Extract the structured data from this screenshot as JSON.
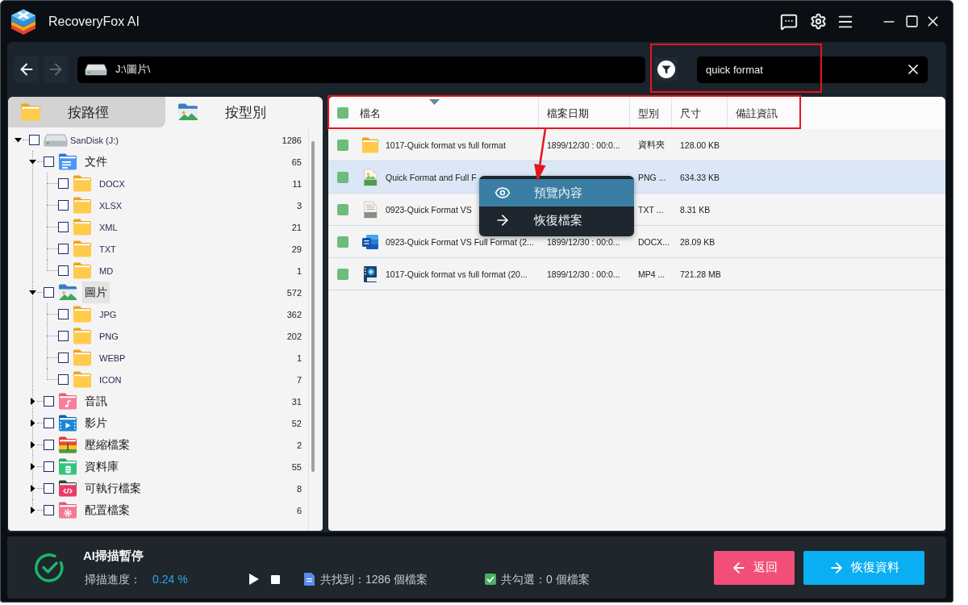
{
  "window": {
    "title": "RecoveryFox AI"
  },
  "toolbar": {
    "navigation": [
      {
        "kind": "back",
        "disabled": false
      },
      {
        "kind": "forward",
        "disabled": true
      }
    ],
    "path": "J:\\圖片\\",
    "search": {
      "value": "quick format"
    }
  },
  "view_tabs": [
    {
      "kind": "folder",
      "label": "按路徑",
      "selected": false
    },
    {
      "kind": "image",
      "label": "按型別",
      "selected": true
    }
  ],
  "tree": [
    {
      "kind": "drive",
      "label": "SanDisk (J:)",
      "count": "1286",
      "checked": false,
      "expanded": true,
      "selected": false,
      "children": [
        {
          "kind": "document",
          "label": "文件",
          "count": "65",
          "checked": false,
          "expanded": true,
          "selected": false,
          "children": [
            {
              "kind": "folder",
              "label": "DOCX",
              "count": "11",
              "checked": false,
              "selected": false
            },
            {
              "kind": "folder",
              "label": "XLSX",
              "count": "3",
              "checked": false,
              "selected": false
            },
            {
              "kind": "folder",
              "label": "XML",
              "count": "21",
              "checked": false,
              "selected": false
            },
            {
              "kind": "folder",
              "label": "TXT",
              "count": "29",
              "checked": false,
              "selected": false
            },
            {
              "kind": "folder",
              "label": "MD",
              "count": "1",
              "checked": false,
              "selected": false
            }
          ]
        },
        {
          "kind": "image",
          "label": "圖片",
          "count": "572",
          "checked": false,
          "expanded": true,
          "selected": true,
          "children": [
            {
              "kind": "folder",
              "label": "JPG",
              "count": "362",
              "checked": false,
              "selected": false
            },
            {
              "kind": "folder",
              "label": "PNG",
              "count": "202",
              "checked": false,
              "selected": false
            },
            {
              "kind": "folder",
              "label": "WEBP",
              "count": "1",
              "checked": false,
              "selected": false
            },
            {
              "kind": "folder",
              "label": "ICON",
              "count": "7",
              "checked": false,
              "selected": false
            }
          ]
        },
        {
          "kind": "audio",
          "label": "音訊",
          "count": "31",
          "checked": false,
          "expanded": false,
          "selected": false
        },
        {
          "kind": "video",
          "label": "影片",
          "count": "52",
          "checked": false,
          "expanded": false,
          "selected": false
        },
        {
          "kind": "archive",
          "label": "壓縮檔案",
          "count": "2",
          "checked": false,
          "expanded": false,
          "selected": false
        },
        {
          "kind": "database",
          "label": "資料庫",
          "count": "55",
          "checked": false,
          "expanded": false,
          "selected": false
        },
        {
          "kind": "executable",
          "label": "可執行檔案",
          "count": "8",
          "checked": false,
          "expanded": false,
          "selected": false
        },
        {
          "kind": "config",
          "label": "配置檔案",
          "count": "6",
          "checked": false,
          "expanded": false,
          "selected": false
        }
      ]
    }
  ],
  "table": {
    "header_checked": false,
    "columns": [
      {
        "label": "檔名",
        "sorted": true
      },
      {
        "label": "檔案日期",
        "sorted": false
      },
      {
        "label": "型別",
        "sorted": false
      },
      {
        "label": "尺寸",
        "sorted": false
      },
      {
        "label": "備註資訊",
        "sorted": false
      }
    ],
    "rows": [
      {
        "kind": "folder",
        "checked": false,
        "selected": false,
        "name": "1017-Quick format vs full format",
        "date": "1899/12/30 : 00:0...",
        "type": "資料夾",
        "size": "128.00 KB"
      },
      {
        "kind": "png",
        "checked": false,
        "selected": true,
        "name": "Quick Format and Full F",
        "type": "PNG ...",
        "size": "634.33 KB"
      },
      {
        "kind": "txt",
        "checked": false,
        "selected": false,
        "name": "0923-Quick Format VS",
        "type": "TXT ...",
        "size": "8.31 KB"
      },
      {
        "kind": "docx",
        "checked": false,
        "selected": false,
        "name": "0923-Quick Format VS Full Format (2...",
        "date": "1899/12/30 : 00:0...",
        "type": "DOCX...",
        "size": "28.09 KB"
      },
      {
        "kind": "mp4",
        "checked": false,
        "selected": false,
        "name": "1017-Quick format vs full format (20...",
        "date": "1899/12/30 : 00:0...",
        "type": "MP4 ...",
        "size": "721.28 MB"
      }
    ]
  },
  "context_menu": {
    "items": [
      {
        "kind": "preview",
        "label": "預覽內容",
        "selected": true
      },
      {
        "kind": "recover",
        "label": "恢復檔案",
        "selected": false
      }
    ]
  },
  "status_bar": {
    "title": "AI掃描暫停",
    "progress_label": "掃描進度：",
    "progress_value": "0.24 %",
    "found": "共找到：1286 個檔案",
    "checked_count": "共勾選：0 個檔案"
  },
  "buttons": [
    {
      "kind": "back",
      "label": "返回"
    },
    {
      "kind": "recover",
      "label": "恢復資料"
    }
  ]
}
